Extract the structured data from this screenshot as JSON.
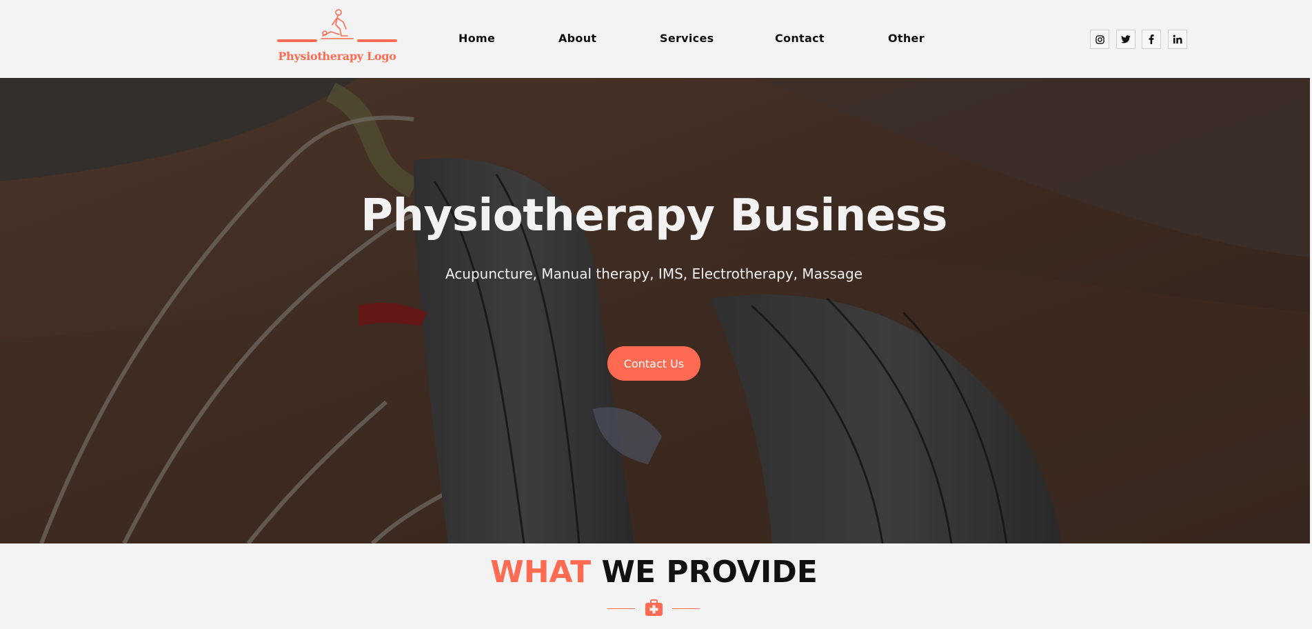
{
  "logo": {
    "text": "Physiotherapy Logo"
  },
  "nav": {
    "items": [
      {
        "label": "Home"
      },
      {
        "label": "About"
      },
      {
        "label": "Services"
      },
      {
        "label": "Contact"
      },
      {
        "label": "Other"
      }
    ]
  },
  "social": [
    {
      "icon": "instagram-icon"
    },
    {
      "icon": "twitter-icon"
    },
    {
      "icon": "facebook-icon"
    },
    {
      "icon": "linkedin-icon"
    }
  ],
  "hero": {
    "title": "Physiotherapy Business",
    "subtitle": "Acupuncture, Manual therapy, IMS, Electrotherapy, Massage",
    "cta_label": "Contact Us"
  },
  "provide": {
    "title_accent": "WHAT",
    "title_rest": " WE PROVIDE",
    "icon": "first-aid-kit-icon"
  },
  "colors": {
    "accent": "#ff6b52",
    "background": "#f3f3f3",
    "text": "#111111"
  }
}
